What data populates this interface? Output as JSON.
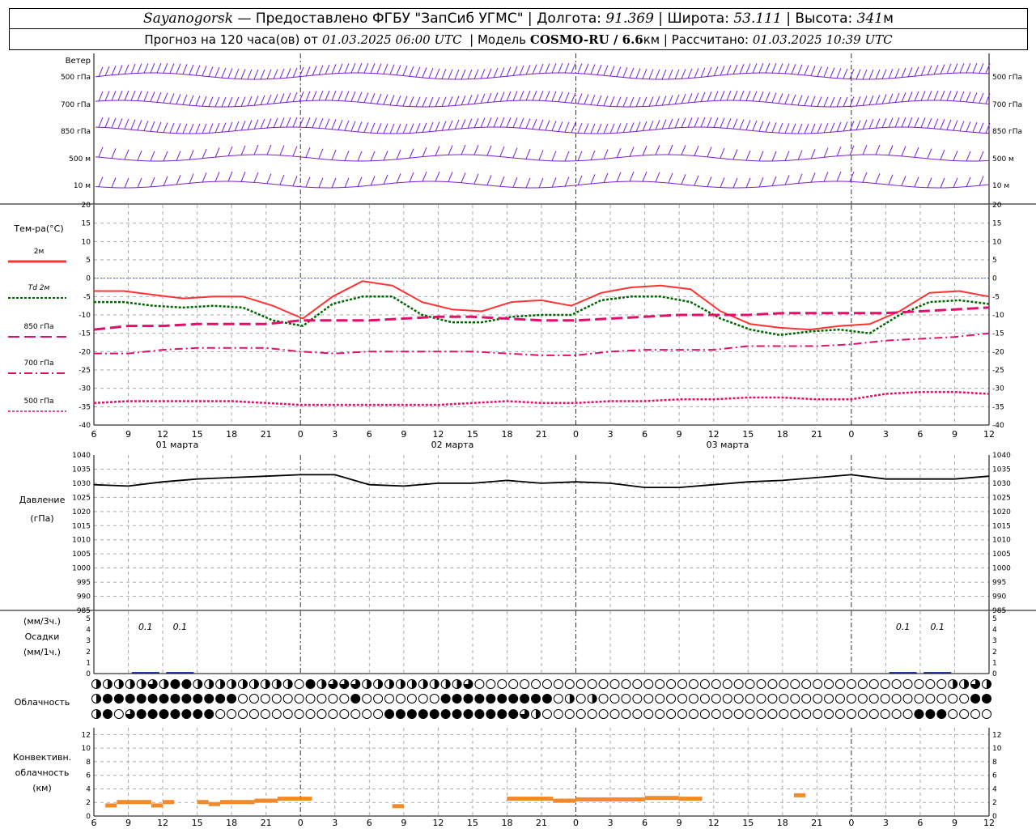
{
  "header": {
    "station": "Sayanogorsk",
    "provider": "— Предоставлено ФГБУ \"ЗапСиб УГМС\"",
    "lon_label": "Долгота:",
    "lon": "91.369",
    "lat_label": "Широта:",
    "lat": "53.111",
    "alt_label": "Высота:",
    "alt": "341",
    "alt_unit": "м",
    "forecast_label": "Прогноз на 120 часа(ов) от",
    "forecast_from": "01.03.2025 06:00 UTC",
    "model_label": "Модель",
    "model": "COSMO-RU / 6.6",
    "model_unit": "км",
    "calc_label": "Рассчитано:",
    "calc": "01.03.2025 10:39 UTC"
  },
  "wind_panel": {
    "title": "Ветер",
    "levels": [
      "500 гПа",
      "700 гПа",
      "850 гПа",
      "500 м",
      "10 м"
    ]
  },
  "temp_panel": {
    "title": "Тем-ра(°C)",
    "legend": [
      {
        "label": "2м",
        "prefix": "",
        "color": "#ff3333",
        "dash": ""
      },
      {
        "label": "2м",
        "prefix": "Td",
        "color": "#006600",
        "dash": "3,2"
      },
      {
        "label": "850 гПа",
        "prefix": "",
        "color": "#e0106b",
        "dash": "14,6"
      },
      {
        "label": "700 гПа",
        "prefix": "",
        "color": "#e0106b",
        "dash": "10,4,2,4"
      },
      {
        "label": "500 гПа",
        "prefix": "",
        "color": "#e0106b",
        "dash": "3,2"
      }
    ],
    "ticks": [
      "20",
      "15",
      "10",
      "5",
      "0",
      "-5",
      "-10",
      "-15",
      "-20",
      "-25",
      "-30",
      "-35",
      "-40"
    ]
  },
  "time_axis": {
    "hours": [
      "6",
      "9",
      "12",
      "15",
      "18",
      "21",
      "0",
      "3",
      "6",
      "9",
      "12",
      "15",
      "18",
      "21",
      "0",
      "3",
      "6",
      "9",
      "12",
      "15",
      "18",
      "21",
      "0",
      "3",
      "6",
      "9",
      "12"
    ],
    "dates": [
      "01 марта",
      "02 марта",
      "03 марта"
    ]
  },
  "pressure_panel": {
    "title": "Давление",
    "unit": "(гПа)",
    "ticks": [
      "1040",
      "1035",
      "1030",
      "1025",
      "1020",
      "1015",
      "1010",
      "1005",
      "1000",
      "995",
      "990",
      "985"
    ]
  },
  "precip_panel": {
    "unit3": "(мм/3ч.)",
    "title": "Осадки",
    "unit1": "(мм/1ч.)",
    "ticks": [
      "5",
      "4",
      "3",
      "2",
      "1",
      "0"
    ],
    "labels": [
      "0.1",
      "0.1",
      "0.1",
      "0.1"
    ]
  },
  "cloud_panel": {
    "title": "Облачность"
  },
  "conv_panel": {
    "title1": "Конвективн.",
    "title2": "облачность",
    "unit": "(км)",
    "ticks": [
      "12",
      "10",
      "8",
      "6",
      "4",
      "2",
      "0"
    ]
  },
  "chart_data": {
    "type": "line",
    "x": [
      6,
      9,
      12,
      15,
      18,
      21,
      24,
      27,
      30,
      33,
      36,
      39,
      42,
      45,
      48,
      51,
      54,
      57,
      60,
      63,
      66,
      69,
      72,
      75,
      78,
      81,
      84
    ],
    "x_ticks": [
      "6",
      "9",
      "12",
      "15",
      "18",
      "21",
      "0",
      "3",
      "6",
      "9",
      "12",
      "15",
      "18",
      "21",
      "0",
      "3",
      "6",
      "9",
      "12",
      "15",
      "18",
      "21",
      "0",
      "3",
      "6",
      "9",
      "12"
    ],
    "temperature": {
      "ylim": [
        -40,
        20
      ],
      "series": [
        {
          "name": "2м",
          "values": [
            -3.5,
            -3.5,
            -4.5,
            -5.5,
            -5,
            -5,
            -7.5,
            -11,
            -5,
            -0.8,
            -2,
            -6.5,
            -8.5,
            -9,
            -6.5,
            -6,
            -7.5,
            -4,
            -2.5,
            -2,
            -3,
            -9,
            -12.5,
            -13.5,
            -14,
            -13,
            -12.5,
            -9,
            -4,
            -3.5,
            -5
          ]
        },
        {
          "name": "Td 2м",
          "values": [
            -6.5,
            -6.5,
            -7.5,
            -8,
            -7.5,
            -8,
            -11.5,
            -13,
            -7,
            -5,
            -5,
            -10,
            -12,
            -12,
            -10.5,
            -10,
            -10,
            -6,
            -5,
            -5,
            -6.5,
            -11,
            -14,
            -15.5,
            -14.5,
            -14,
            -15,
            -10,
            -6.5,
            -6,
            -7
          ]
        },
        {
          "name": "850 гПа",
          "values": [
            -14,
            -13,
            -13,
            -12.5,
            -12.5,
            -12.5,
            -11.5,
            -11.5,
            -11.5,
            -11,
            -10.5,
            -10.5,
            -11,
            -11.5,
            -11.5,
            -11,
            -10.5,
            -10,
            -10,
            -10,
            -9.5,
            -9.5,
            -9.5,
            -9.5,
            -9,
            -8.5,
            -8
          ]
        },
        {
          "name": "700 гПа",
          "values": [
            -20.5,
            -20.5,
            -19.5,
            -19,
            -19,
            -19,
            -20,
            -20.5,
            -20,
            -20,
            -20,
            -20,
            -20.5,
            -21,
            -21,
            -20,
            -19.5,
            -19.5,
            -19.5,
            -18.5,
            -18.5,
            -18.5,
            -18,
            -17,
            -16.5,
            -16,
            -15
          ]
        },
        {
          "name": "500 гПа",
          "values": [
            -34,
            -33.5,
            -33.5,
            -33.5,
            -33.5,
            -34,
            -34.5,
            -34.5,
            -34.5,
            -34.5,
            -34.5,
            -34,
            -33.5,
            -34,
            -34,
            -33.5,
            -33.5,
            -33,
            -33,
            -32.5,
            -32.5,
            -33,
            -33,
            -31.5,
            -31,
            -31,
            -31.5
          ]
        }
      ]
    },
    "pressure": {
      "ylim": [
        985,
        1040
      ],
      "values": [
        1029.5,
        1029,
        1030.5,
        1031.5,
        1032,
        1032.5,
        1033,
        1033,
        1029.5,
        1029,
        1030,
        1030,
        1031,
        1030,
        1030.5,
        1030,
        1028.5,
        1028.5,
        1029.5,
        1030.5,
        1031,
        1032,
        1033,
        1031.5,
        1031.5,
        1031.5,
        1032.5
      ]
    },
    "precip_labels_hours": [
      9,
      12,
      75,
      78
    ],
    "cloud_rows": [
      "HHHHHHQQHFFFHHHHHHHHHHHHHOFHHQQQQHHHHHHHHHHHHHQOOOOOOOOOOOOOOOOOOOOOOOOOOOOOOOOOOOOOOOOOOOOOOOOOOOOOOOOOOOHHHQHH",
      "HFFFFFFFFFFFFFFFFFFFFFFFFFFOOOOOOOOOOOOOOOOOOOOOHFFHOOOOOOOOOOOOOOFFFFFFFFFFFFFFFFFFFFFFFOOHOOHHOOOOOOOOOOOOOOOOOOOOOOOOOOOOOOOOOOOOOOOOOOOOOOOOOOOOOOOOOOOOOOOOOOOOOOOOOFHFHH",
      "HFFOOHQHFFFFFFFFFFFFFFFQOOOOOOOOOOOOOOOOOOOOOOOOOOOOOOOOOFFFFFFFFFFFFFFFFFFFFFFFFFFQQOHOOOOOOOOOOOOOOOOOOOOOOOOOOOOOOOOOOOOOOOOOOOOOOOOOOOOOOOOOOOOOOOOOOOOOOOOOOOFFFFFFFOOOOOOOFH"
    ],
    "convective_bars": [
      {
        "from": 7,
        "to": 8,
        "value": 1.5
      },
      {
        "from": 8,
        "to": 11,
        "value": 2
      },
      {
        "from": 11,
        "to": 12,
        "value": 1.5
      },
      {
        "from": 12,
        "to": 13,
        "value": 2
      },
      {
        "from": 15,
        "to": 16,
        "value": 2
      },
      {
        "from": 16,
        "to": 17,
        "value": 1.7
      },
      {
        "from": 17,
        "to": 20,
        "value": 2
      },
      {
        "from": 20,
        "to": 22,
        "value": 2.2
      },
      {
        "from": 22,
        "to": 24,
        "value": 2.5
      },
      {
        "from": 24,
        "to": 25,
        "value": 2.5
      },
      {
        "from": 32,
        "to": 33,
        "value": 1.4
      },
      {
        "from": 42,
        "to": 46,
        "value": 2.5
      },
      {
        "from": 46,
        "to": 48,
        "value": 2.2
      },
      {
        "from": 48,
        "to": 54,
        "value": 2.4
      },
      {
        "from": 54,
        "to": 57,
        "value": 2.6
      },
      {
        "from": 57,
        "to": 59,
        "value": 2.5
      },
      {
        "from": 67,
        "to": 68,
        "value": 3
      }
    ]
  }
}
